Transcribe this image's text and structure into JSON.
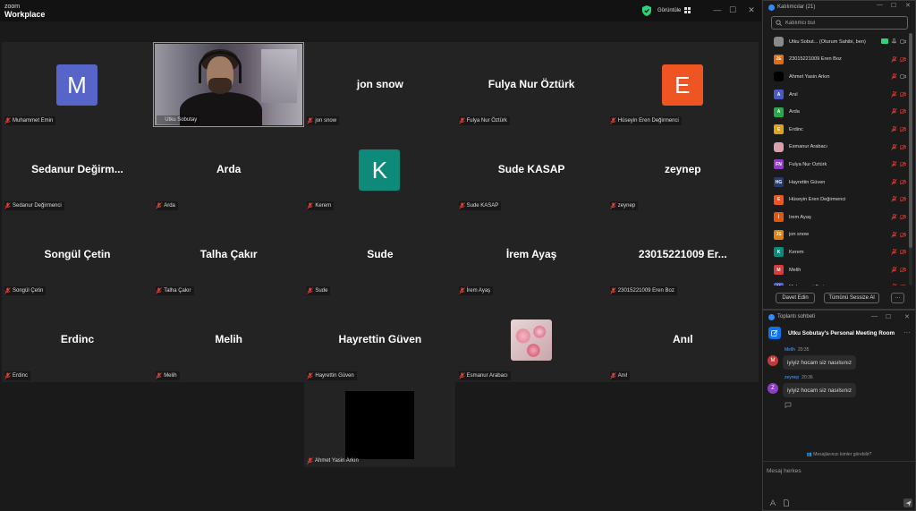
{
  "app": {
    "logo_line1": "zoom",
    "logo_line2": "Workplace",
    "view_label": "Görüntüle"
  },
  "colors": {
    "active_speaker": "#2dd37b",
    "accent": "#0e72ed",
    "mic_muted": "#e0443a",
    "link": "#4aa3ff"
  },
  "tiles": [
    {
      "name": "Muhammet Emin",
      "label": "Muhammet Emin",
      "avatar": "M",
      "avatar_color": "#5865c8"
    },
    {
      "name": "Utku Sobutay",
      "label": "Utku Sobutay",
      "video": true
    },
    {
      "name": "jon snow",
      "label": "jon snow"
    },
    {
      "name": "Fulya Nur Öztürk",
      "label": "Fulya Nur Öztürk"
    },
    {
      "name": "Hüseyin Eren Değirmenci",
      "label": "Hüseyin Eren Değirmenci",
      "avatar": "E",
      "avatar_color": "#ee5522"
    },
    {
      "name": "Sedanur  Değirm...",
      "label": "Sedanur Değirmenci"
    },
    {
      "name": "Arda",
      "label": "Arda"
    },
    {
      "name": "Kerem",
      "label": "Kerem",
      "avatar": "K",
      "avatar_color": "#0e8a7a"
    },
    {
      "name": "Sude KASAP",
      "label": "Sude KASAP"
    },
    {
      "name": "zeynep",
      "label": "zeynep"
    },
    {
      "name": "Songül Çetin",
      "label": "Songül Çetin"
    },
    {
      "name": "Talha Çakır",
      "label": "Talha Çakır"
    },
    {
      "name": "Sude",
      "label": "Sude"
    },
    {
      "name": "İrem Ayaş",
      "label": "İrem Ayaş"
    },
    {
      "name": "23015221009   Er...",
      "label": "23015221009 Eren Boz"
    },
    {
      "name": "Erdinc",
      "label": "Erdinc"
    },
    {
      "name": "Melih",
      "label": "Melih"
    },
    {
      "name": "Hayrettin Güven",
      "label": "Hayrettin Güven"
    },
    {
      "name": "Esmanur Arabacı",
      "label": "Esmanur Arabacı",
      "photo": true
    },
    {
      "name": "Anıl",
      "label": "Anıl"
    }
  ],
  "tile_extra": {
    "label": "Ahmet Yasin Arkın"
  },
  "participants": {
    "title": "Katılımcılar (21)",
    "search_placeholder": "Katılımcı bul",
    "items": [
      {
        "name": "Utku Sobut...  (Oturum Sahibi, ben)",
        "avatar": "",
        "color": "#8a8a8a",
        "host": true
      },
      {
        "name": "23015221009 Eren Boz",
        "avatar": "2E",
        "color": "#e36a12"
      },
      {
        "name": "Ahmet Yasin Arkın",
        "avatar": "",
        "color": "#000000"
      },
      {
        "name": "Anıl",
        "avatar": "A",
        "color": "#4a5cc4"
      },
      {
        "name": "Arda",
        "avatar": "A",
        "color": "#2aa84a"
      },
      {
        "name": "Erdinc",
        "avatar": "E",
        "color": "#e0a020"
      },
      {
        "name": "Esmanur Arabacı",
        "avatar": "",
        "color": "#d9a0a8"
      },
      {
        "name": "Fulya Nur Öztürk",
        "avatar": "FN",
        "color": "#8d3dc4"
      },
      {
        "name": "Hayrettin Güven",
        "avatar": "HG",
        "color": "#2a3a66"
      },
      {
        "name": "Hüseyin Eren Değirmenci",
        "avatar": "E",
        "color": "#ee5522"
      },
      {
        "name": "İrem Ayaş",
        "avatar": "İ",
        "color": "#e3560f"
      },
      {
        "name": "jon snow",
        "avatar": "JS",
        "color": "#e0820e"
      },
      {
        "name": "Kerem",
        "avatar": "K",
        "color": "#0e8a7a"
      },
      {
        "name": "Melih",
        "avatar": "M",
        "color": "#d63c3c"
      },
      {
        "name": "Muhammet Emin",
        "avatar": "M",
        "color": "#5865c8"
      }
    ],
    "invite_label": "Davet Edin",
    "mute_all_label": "Tümünü Sessize Al",
    "more_label": "···"
  },
  "chat": {
    "title": "Toplantı sohbeti",
    "room": "Utku Sobutay's Personal Meeting Room",
    "messages": [
      {
        "sender": "Melih",
        "time": "20:35",
        "text": "iyiyiz hocam siz nasılsınız",
        "initial": "M",
        "color": "#c03a3a"
      },
      {
        "sender": "zeynep",
        "time": "20:36",
        "text": "iyiyiz hocam siz nasılsınız",
        "initial": "Z",
        "color": "#8d3dc4"
      }
    ],
    "who_can_see": "Mesajlarınızı kimler görebilir?",
    "input_placeholder": "Mesaj herkes"
  }
}
